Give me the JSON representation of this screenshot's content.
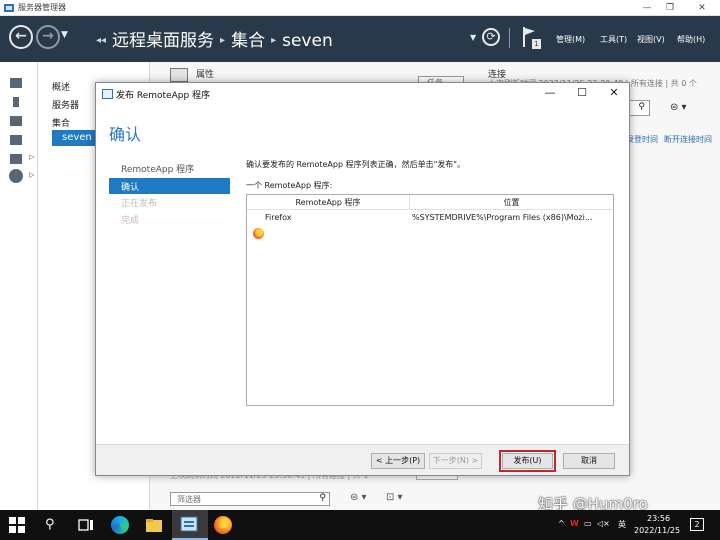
{
  "app": {
    "title": "服务器管理器",
    "window_controls": {
      "minimize": "—",
      "maximize": "❐",
      "close": "✕"
    }
  },
  "header": {
    "breadcrumb_root": "远程桌面服务",
    "breadcrumb_mid": "集合",
    "breadcrumb_leaf": "seven",
    "notification_count": "1",
    "menus": [
      "管理(M)",
      "工具(T)",
      "视图(V)",
      "帮助(H)"
    ]
  },
  "nav": {
    "items": [
      "概述",
      "服务器",
      "集合"
    ],
    "selected": "seven"
  },
  "background": {
    "properties_title": "属性",
    "tasks_label": "任务",
    "connections_title": "连接",
    "connections_summary": "上次刷新时间 2022/11/25 23:30:49 | 所有连接 | 共 0 个",
    "login_time_col": "录登时间",
    "disconnect_time_col": "断开连接时间",
    "bottom_status": "上次刷新时间 2022/11/25 23:30:49 | 所有连接 | 共 1",
    "filter_placeholder": "筛选器"
  },
  "dialog": {
    "title": "发布 RemoteApp 程序",
    "heading": "确认",
    "steps": [
      {
        "label": "RemoteApp 程序",
        "state": "done"
      },
      {
        "label": "确认",
        "state": "active"
      },
      {
        "label": "正在发布",
        "state": "disabled"
      },
      {
        "label": "完成",
        "state": "disabled"
      }
    ],
    "description": "确认要发布的 RemoteApp 程序列表正确，然后单击\"发布\"。",
    "list_label": "一个 RemoteApp 程序:",
    "table": {
      "columns": [
        "RemoteApp 程序",
        "位置"
      ],
      "rows": [
        {
          "program": "Firefox",
          "location": "%SYSTEMDRIVE%\\Program Files (x86)\\Mozi..."
        }
      ]
    },
    "buttons": {
      "previous": "< 上一步(P)",
      "next": "下一步(N) >",
      "publish": "发布(U)",
      "cancel": "取消"
    }
  },
  "taskbar": {
    "ime": "英",
    "time": "23:56",
    "date": "2022/11/25",
    "notification_badge": "2"
  },
  "watermark": "知乎 @Hum0ro"
}
